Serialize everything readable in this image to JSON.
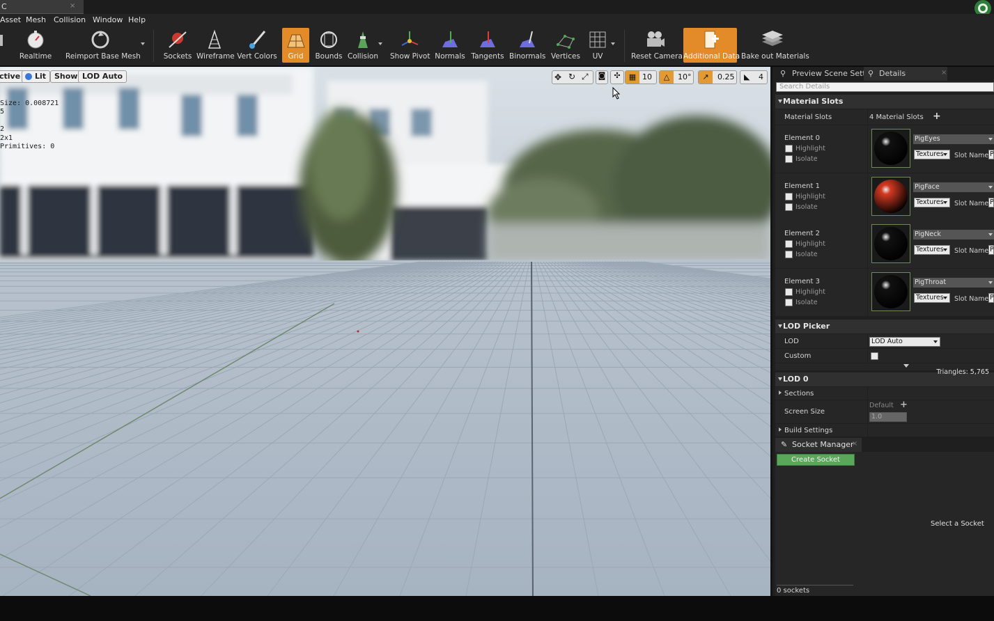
{
  "titlebar": {
    "doc_tab_label": "C",
    "close_glyph": "×"
  },
  "menu": [
    "Asset",
    "Mesh",
    "Collision",
    "Window",
    "Help"
  ],
  "toolbar": {
    "buttons": [
      {
        "label": "Realtime",
        "icon": "stopwatch-icon"
      },
      {
        "label": "Reimport Base Mesh",
        "icon": "reimport-icon"
      },
      {
        "label": "Sockets",
        "icon": "sockets-icon"
      },
      {
        "label": "Wireframe",
        "icon": "wireframe-icon"
      },
      {
        "label": "Vert Colors",
        "icon": "paintbrush-icon"
      },
      {
        "label": "Grid",
        "icon": "grid-icon",
        "active": true
      },
      {
        "label": "Bounds",
        "icon": "bounds-icon"
      },
      {
        "label": "Collision",
        "icon": "collision-icon"
      },
      {
        "label": "Show Pivot",
        "icon": "pivot-icon"
      },
      {
        "label": "Normals",
        "icon": "normals-icon"
      },
      {
        "label": "Tangents",
        "icon": "tangents-icon"
      },
      {
        "label": "Binormals",
        "icon": "binormals-icon"
      },
      {
        "label": "Vertices",
        "icon": "vertices-icon"
      },
      {
        "label": "UV",
        "icon": "uv-icon"
      },
      {
        "label": "Reset Camera",
        "icon": "camera-icon"
      },
      {
        "label": "Additional Data",
        "icon": "additional-data-icon",
        "active": true
      },
      {
        "label": "Bake out Materials",
        "icon": "bake-icon"
      }
    ]
  },
  "viewport": {
    "perspective_label": "ctive",
    "lit_label": "Lit",
    "show_label": "Show",
    "lod_label": "LOD Auto",
    "stats": [
      "Size: 0.008721",
      "5",
      "",
      "2",
      "2x1",
      "Primitives: 0"
    ],
    "grid_snap_value": "10",
    "rotation_snap_value": "10°",
    "scale_snap_value": "0.25",
    "camera_speed_value": "4"
  },
  "panel": {
    "tabs": [
      "Preview Scene Sett",
      "Details"
    ],
    "search_placeholder": "Search Details",
    "material_slots": {
      "category": "Material Slots",
      "label": "Material Slots",
      "count_text": "4 Material Slots",
      "highlight_label": "Highlight",
      "isolate_label": "Isolate",
      "textures_label": "Textures",
      "slot_name_label": "Slot Name",
      "slot_name_value": "P",
      "elements": [
        {
          "label": "Element 0",
          "material": "PigEyes",
          "color": "#111111"
        },
        {
          "label": "Element 1",
          "material": "PigFace",
          "color": "#d63a22"
        },
        {
          "label": "Element 2",
          "material": "PigNeck",
          "color": "#111111"
        },
        {
          "label": "Element 3",
          "material": "PigThroat",
          "color": "#111111"
        }
      ]
    },
    "lod_picker": {
      "category": "LOD Picker",
      "lod_label": "LOD",
      "lod_value": "LOD Auto",
      "custom_label": "Custom"
    },
    "lod0": {
      "category": "LOD 0",
      "triangles": "Triangles: 5,765",
      "sections_label": "Sections",
      "screen_size_label": "Screen Size",
      "default_label": "Default",
      "screen_size_value": "1.0",
      "build_settings_label": "Build Settings"
    },
    "socket_manager": {
      "tab_label": "Socket Manager",
      "create_button": "Create Socket",
      "empty_text": "Select a Socket",
      "count_text": "0 sockets"
    }
  },
  "colors": {
    "accent_orange": "#e38b28",
    "create_green": "#5aa65a"
  }
}
